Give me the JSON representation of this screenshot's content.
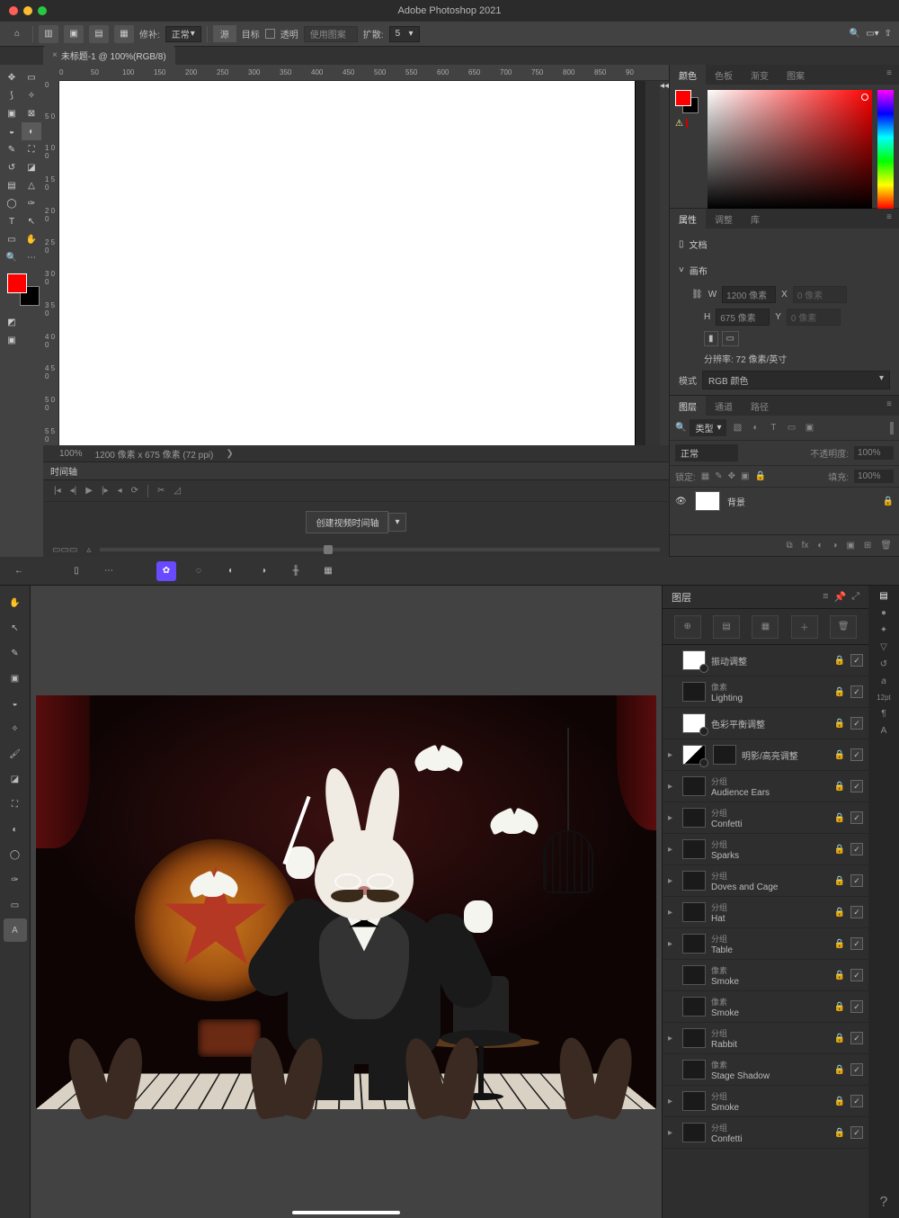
{
  "photoshop": {
    "title": "Adobe Photoshop 2021",
    "document_tab": "未标题-1 @ 100%(RGB/8)",
    "options_bar": {
      "healing_label": "修补:",
      "healing_mode": "正常",
      "source": "源",
      "dest": "目标",
      "transparent": "透明",
      "use_pattern": "使用图案",
      "diffusion_label": "扩散:",
      "diffusion_value": "5"
    },
    "status": {
      "zoom": "100%",
      "doc_info": "1200 像素 x 675 像素 (72 ppi)"
    },
    "ruler_h": [
      "0",
      "50",
      "100",
      "150",
      "200",
      "250",
      "300",
      "350",
      "400",
      "450",
      "500",
      "550",
      "600",
      "650",
      "700",
      "750",
      "800",
      "850",
      "90"
    ],
    "ruler_v": [
      "0",
      "5 0",
      "1 0 0",
      "1 5 0",
      "2 0 0",
      "2 5 0",
      "3 0 0",
      "3 5 0",
      "4 0 0",
      "4 5 0",
      "5 0 0",
      "5 5 0"
    ],
    "timeline": {
      "tab": "时间轴",
      "create_btn": "创建视频时间轴"
    },
    "panels": {
      "color_tabs": [
        "颜色",
        "色板",
        "渐变",
        "图案"
      ],
      "prop_tabs": [
        "属性",
        "调整",
        "库"
      ],
      "prop_heading": "文档",
      "canvas_heading": "画布",
      "width_label": "W",
      "width_value": "1200 像素",
      "x_label": "X",
      "height_label": "H",
      "height_value": "675 像素",
      "y_label": "Y",
      "resolution": "分辨率: 72 像素/英寸",
      "mode_label": "模式",
      "mode_value": "RGB 颜色",
      "layer_tabs": [
        "图层",
        "通道",
        "路径"
      ],
      "kind_label": "类型",
      "blend_mode": "正常",
      "opacity_label": "不透明度:",
      "opacity_value": "100%",
      "lock_label": "锁定:",
      "fill_label": "填充:",
      "fill_value": "100%",
      "bg_layer": "背景"
    }
  },
  "affinity": {
    "panel_title": "图层",
    "layer_kind_adjust": "调整",
    "layer_kind_pixel": "像素",
    "layer_kind_group": "分组",
    "layers": [
      {
        "arrow": false,
        "thumb": "white",
        "dot": true,
        "kind": "",
        "name": "振动调整",
        "lock": true,
        "check": true
      },
      {
        "arrow": false,
        "thumb": "dark",
        "dot": false,
        "kind": "像素",
        "name": "Lighting",
        "lock": true,
        "check": true
      },
      {
        "arrow": false,
        "thumb": "white",
        "dot": true,
        "kind": "",
        "name": "色彩平衡调整",
        "lock": true,
        "check": true
      },
      {
        "arrow": true,
        "thumb": "mask",
        "dot": true,
        "kind": "",
        "name": "明影/高亮调整",
        "lock": true,
        "check": true
      },
      {
        "arrow": true,
        "thumb": "dark",
        "dot": false,
        "kind": "分组",
        "name": "Audience Ears",
        "lock": true,
        "check": true
      },
      {
        "arrow": true,
        "thumb": "dark",
        "dot": false,
        "kind": "分组",
        "name": "Confetti",
        "lock": true,
        "check": true
      },
      {
        "arrow": true,
        "thumb": "dark",
        "dot": false,
        "kind": "分组",
        "name": "Sparks",
        "lock": true,
        "check": true
      },
      {
        "arrow": true,
        "thumb": "dark",
        "dot": false,
        "kind": "分组",
        "name": "Doves and Cage",
        "lock": true,
        "check": true
      },
      {
        "arrow": true,
        "thumb": "dark",
        "dot": false,
        "kind": "分组",
        "name": "Hat",
        "lock": true,
        "check": true
      },
      {
        "arrow": true,
        "thumb": "dark",
        "dot": false,
        "kind": "分组",
        "name": "Table",
        "lock": true,
        "check": true
      },
      {
        "arrow": false,
        "thumb": "dark",
        "dot": false,
        "kind": "像素",
        "name": "Smoke",
        "lock": true,
        "check": true
      },
      {
        "arrow": false,
        "thumb": "dark",
        "dot": false,
        "kind": "像素",
        "name": "Smoke",
        "lock": true,
        "check": true
      },
      {
        "arrow": true,
        "thumb": "dark",
        "dot": false,
        "kind": "分组",
        "name": "Rabbit",
        "lock": true,
        "check": true
      },
      {
        "arrow": false,
        "thumb": "dark",
        "dot": false,
        "kind": "像素",
        "name": "Stage Shadow",
        "lock": true,
        "check": true
      },
      {
        "arrow": true,
        "thumb": "dark",
        "dot": false,
        "kind": "分组",
        "name": "Smoke",
        "lock": true,
        "check": true
      },
      {
        "arrow": true,
        "thumb": "dark",
        "dot": false,
        "kind": "分组",
        "name": "Confetti",
        "lock": true,
        "check": true
      }
    ],
    "font_size": "12pt",
    "help": "?"
  }
}
